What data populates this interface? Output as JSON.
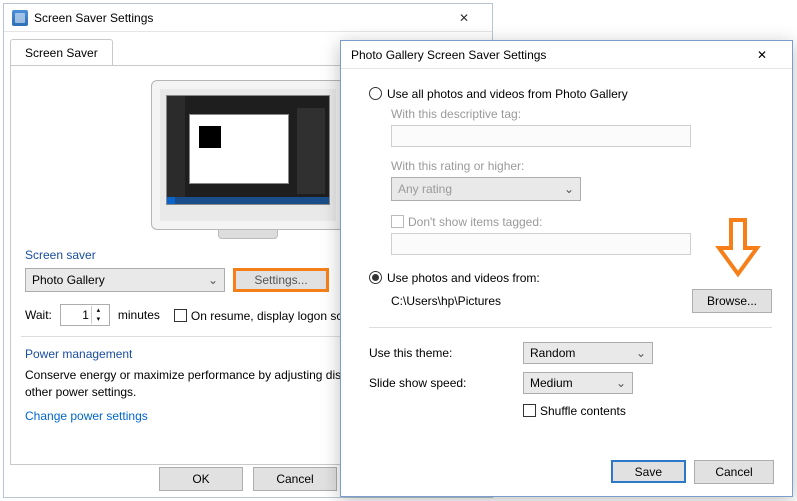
{
  "win1": {
    "title": "Screen Saver Settings",
    "tab": "Screen Saver",
    "group_screensaver": "Screen saver",
    "screensaver_value": "Photo Gallery",
    "settings_btn": "Settings...",
    "wait_label": "Wait:",
    "wait_value": "1",
    "wait_unit": "minutes",
    "on_resume": "On resume, display logon screen",
    "group_power": "Power management",
    "power_text": "Conserve energy or maximize performance by adjusting display brightness and other power settings.",
    "power_link": "Change power settings",
    "ok": "OK",
    "cancel": "Cancel"
  },
  "win2": {
    "title": "Photo Gallery Screen Saver Settings",
    "opt_all": "Use all photos and videos from Photo Gallery",
    "tag_label": "With this descriptive tag:",
    "rating_label": "With this rating or higher:",
    "rating_value": "Any rating",
    "exclude_label": "Don't show items tagged:",
    "opt_from": "Use photos and videos from:",
    "path": "C:\\Users\\hp\\Pictures",
    "browse": "Browse...",
    "theme_label": "Use this theme:",
    "theme_value": "Random",
    "speed_label": "Slide show speed:",
    "speed_value": "Medium",
    "shuffle": "Shuffle contents",
    "save": "Save",
    "cancel": "Cancel"
  }
}
